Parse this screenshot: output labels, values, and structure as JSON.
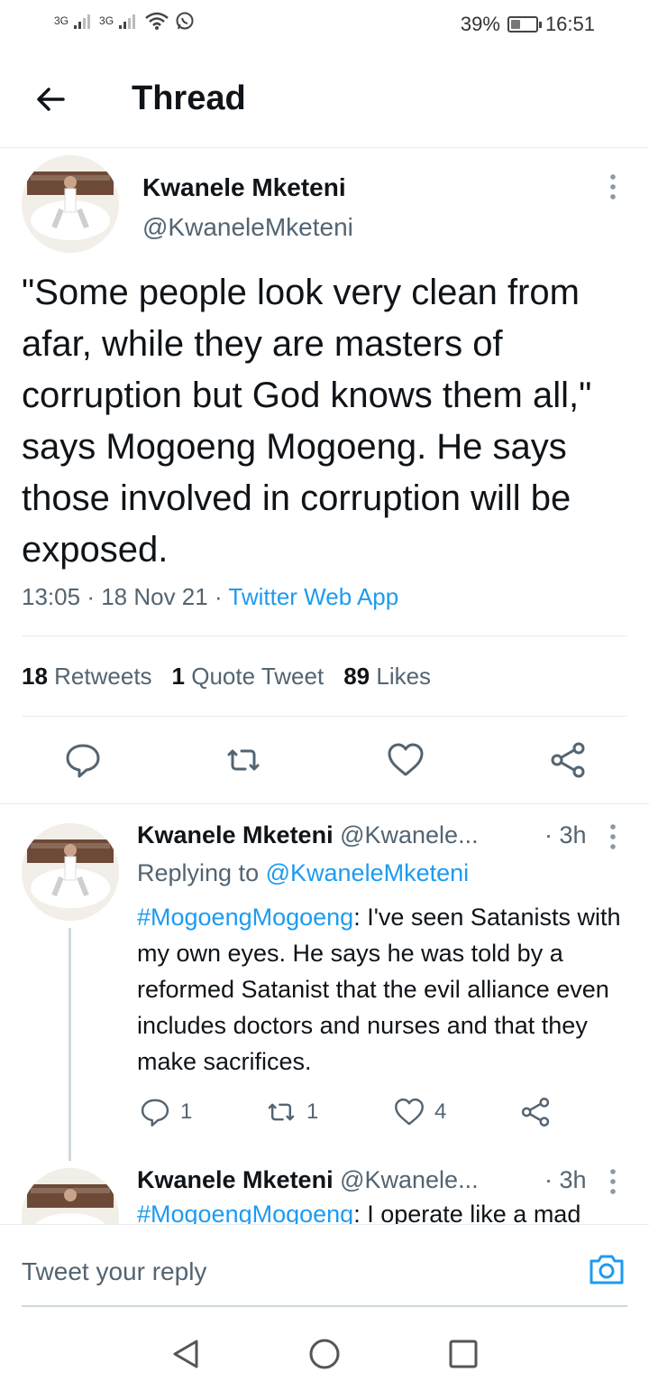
{
  "status_bar": {
    "signal1": "3G",
    "signal2": "3G",
    "battery": "39%",
    "battery_level": 0.39,
    "time": "16:51",
    "icons": [
      "signal-icon",
      "signal-icon",
      "wifi-icon",
      "whatsapp-icon",
      "battery-icon"
    ]
  },
  "header": {
    "title": "Thread"
  },
  "tweet": {
    "name": "Kwanele Mketeni",
    "handle": "@KwaneleMketeni",
    "text": "\"Some people look very clean from afar, while they are masters of corruption but God knows them all,\" says Mogoeng Mogoeng. He says those involved in corruption will be exposed.",
    "time": "13:05",
    "date": "18 Nov 21",
    "source": "Twitter Web App",
    "retweets_count": "18",
    "retweets_label": "Retweets",
    "quotes_count": "1",
    "quotes_label": "Quote Tweet",
    "likes_count": "89",
    "likes_label": "Likes"
  },
  "replies": [
    {
      "name": "Kwanele Mketeni",
      "handle": "@Kwanele...",
      "time": "· 3h",
      "replying_label": "Replying to",
      "replying_to": "@KwaneleMketeni",
      "hashtag": "#MogoengMogoeng",
      "text": ": I've seen Satanists with my own eyes. He says he was told by a reformed Satanist that the evil alliance even includes doctors and nurses and that they make sacrifices.",
      "reply_count": "1",
      "retweet_count": "1",
      "like_count": "4"
    },
    {
      "name": "Kwanele Mketeni",
      "handle": "@Kwanele...",
      "time": "· 3h",
      "hashtag": "#MogoengMogoeng",
      "text": ": I operate like a mad"
    }
  ],
  "reply_bar": {
    "placeholder": "Tweet your reply"
  },
  "colors": {
    "accent": "#1d9bf0",
    "secondary": "#536471",
    "text": "#0f1419"
  }
}
